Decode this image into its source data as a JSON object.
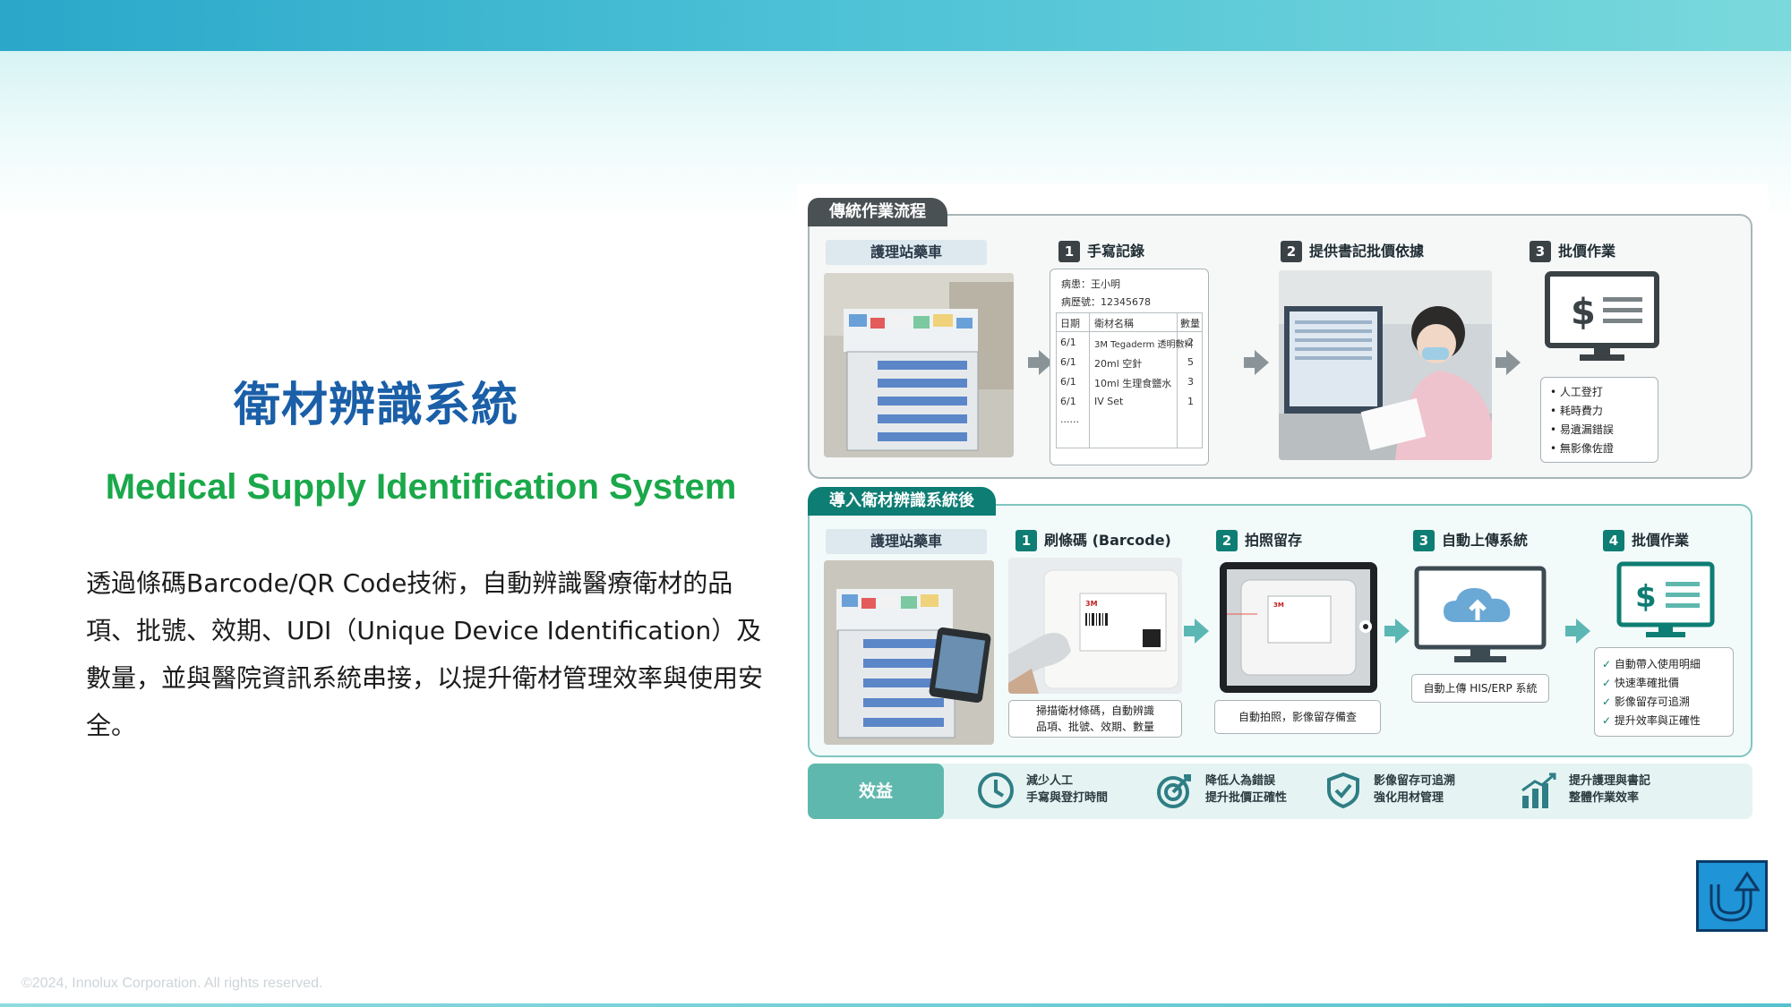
{
  "slide": {
    "title_zh": "衛材辨識系統",
    "title_en": "Medical Supply Identification System",
    "body": "透過條碼Barcode/QR Code技術，自動辨識醫療衛材的品項、批號、效期、UDI（Unique Device Identification）及數量，並與醫院資訊系統串接，以提升衛材管理效率與使用安全。",
    "copyright": "©2024, Innolux Corporation. All rights reserved."
  },
  "infographic": {
    "traditional": {
      "tab": "傳統作業流程",
      "cart_label": "護理站藥車",
      "steps": [
        {
          "num": "1",
          "label": "手寫記錄"
        },
        {
          "num": "2",
          "label": "提供書記批價依據"
        },
        {
          "num": "3",
          "label": "批價作業"
        }
      ],
      "record": {
        "patient": "病患：王小明",
        "chart_no": "病歷號：12345678",
        "headers": [
          "日期",
          "衛材名稱",
          "數量"
        ],
        "rows": [
          [
            "6/1",
            "3M Tegaderm 透明敷料",
            "2"
          ],
          [
            "6/1",
            "20ml 空針",
            "5"
          ],
          [
            "6/1",
            "10ml 生理食鹽水",
            "3"
          ],
          [
            "6/1",
            "IV Set",
            "1"
          ]
        ],
        "more": "......"
      },
      "issues": [
        "• 人工登打",
        "• 耗時費力",
        "• 易遺漏錯誤",
        "• 無影像佐證"
      ]
    },
    "new": {
      "tab": "導入衛材辨識系統後",
      "cart_label": "護理站藥車",
      "steps": [
        {
          "num": "1",
          "label": "刷條碼 (Barcode)"
        },
        {
          "num": "2",
          "label": "拍照留存"
        },
        {
          "num": "3",
          "label": "自動上傳系統"
        },
        {
          "num": "4",
          "label": "批價作業"
        }
      ],
      "caption_scan": "掃描衛材條碼，自動辨識\n品項、批號、效期、數量",
      "caption_photo": "自動拍照，影像留存備查",
      "caption_upload": "自動上傳 HIS/ERP 系統",
      "results": [
        "自動帶入使用明細",
        "快速準確批價",
        "影像留存可追溯",
        "提升效率與正確性"
      ]
    },
    "benefits": {
      "tag": "效益",
      "items": [
        {
          "icon": "clock-icon",
          "line1": "減少人工",
          "line2": "手寫與登打時間"
        },
        {
          "icon": "target-icon",
          "line1": "降低人為錯誤",
          "line2": "提升批價正確性"
        },
        {
          "icon": "shield-icon",
          "line1": "影像留存可追溯",
          "line2": "強化用材管理"
        },
        {
          "icon": "growth-chart-icon",
          "line1": "提升護理與書記",
          "line2": "整體作業效率"
        }
      ]
    }
  },
  "colors": {
    "title_blue": "#1a5fa8",
    "title_green": "#1aa84a",
    "teal": "#0e7d73",
    "return_button": "#1f94d6"
  }
}
